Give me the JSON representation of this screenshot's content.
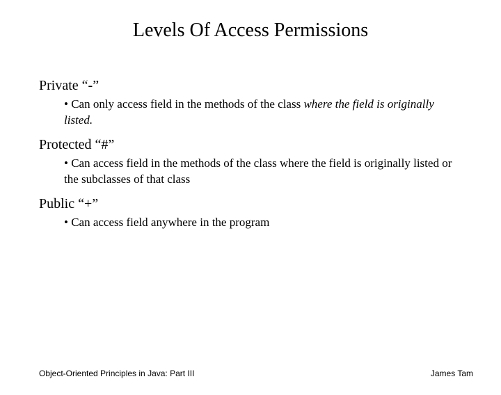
{
  "title": "Levels Of Access Permissions",
  "levels": {
    "private": {
      "label": "Private “-”",
      "bullet_prefix": "• Can only access field in the methods of the class ",
      "bullet_italic": "where the field is originally listed."
    },
    "protected": {
      "label": "Protected “#”",
      "bullet": "• Can access field in the methods of the class where the field is originally listed or the subclasses of that class"
    },
    "public": {
      "label": "Public “+”",
      "bullet": "• Can access field anywhere in the program"
    }
  },
  "footer": {
    "left": "Object-Oriented Principles in Java: Part III",
    "right": "James Tam"
  }
}
